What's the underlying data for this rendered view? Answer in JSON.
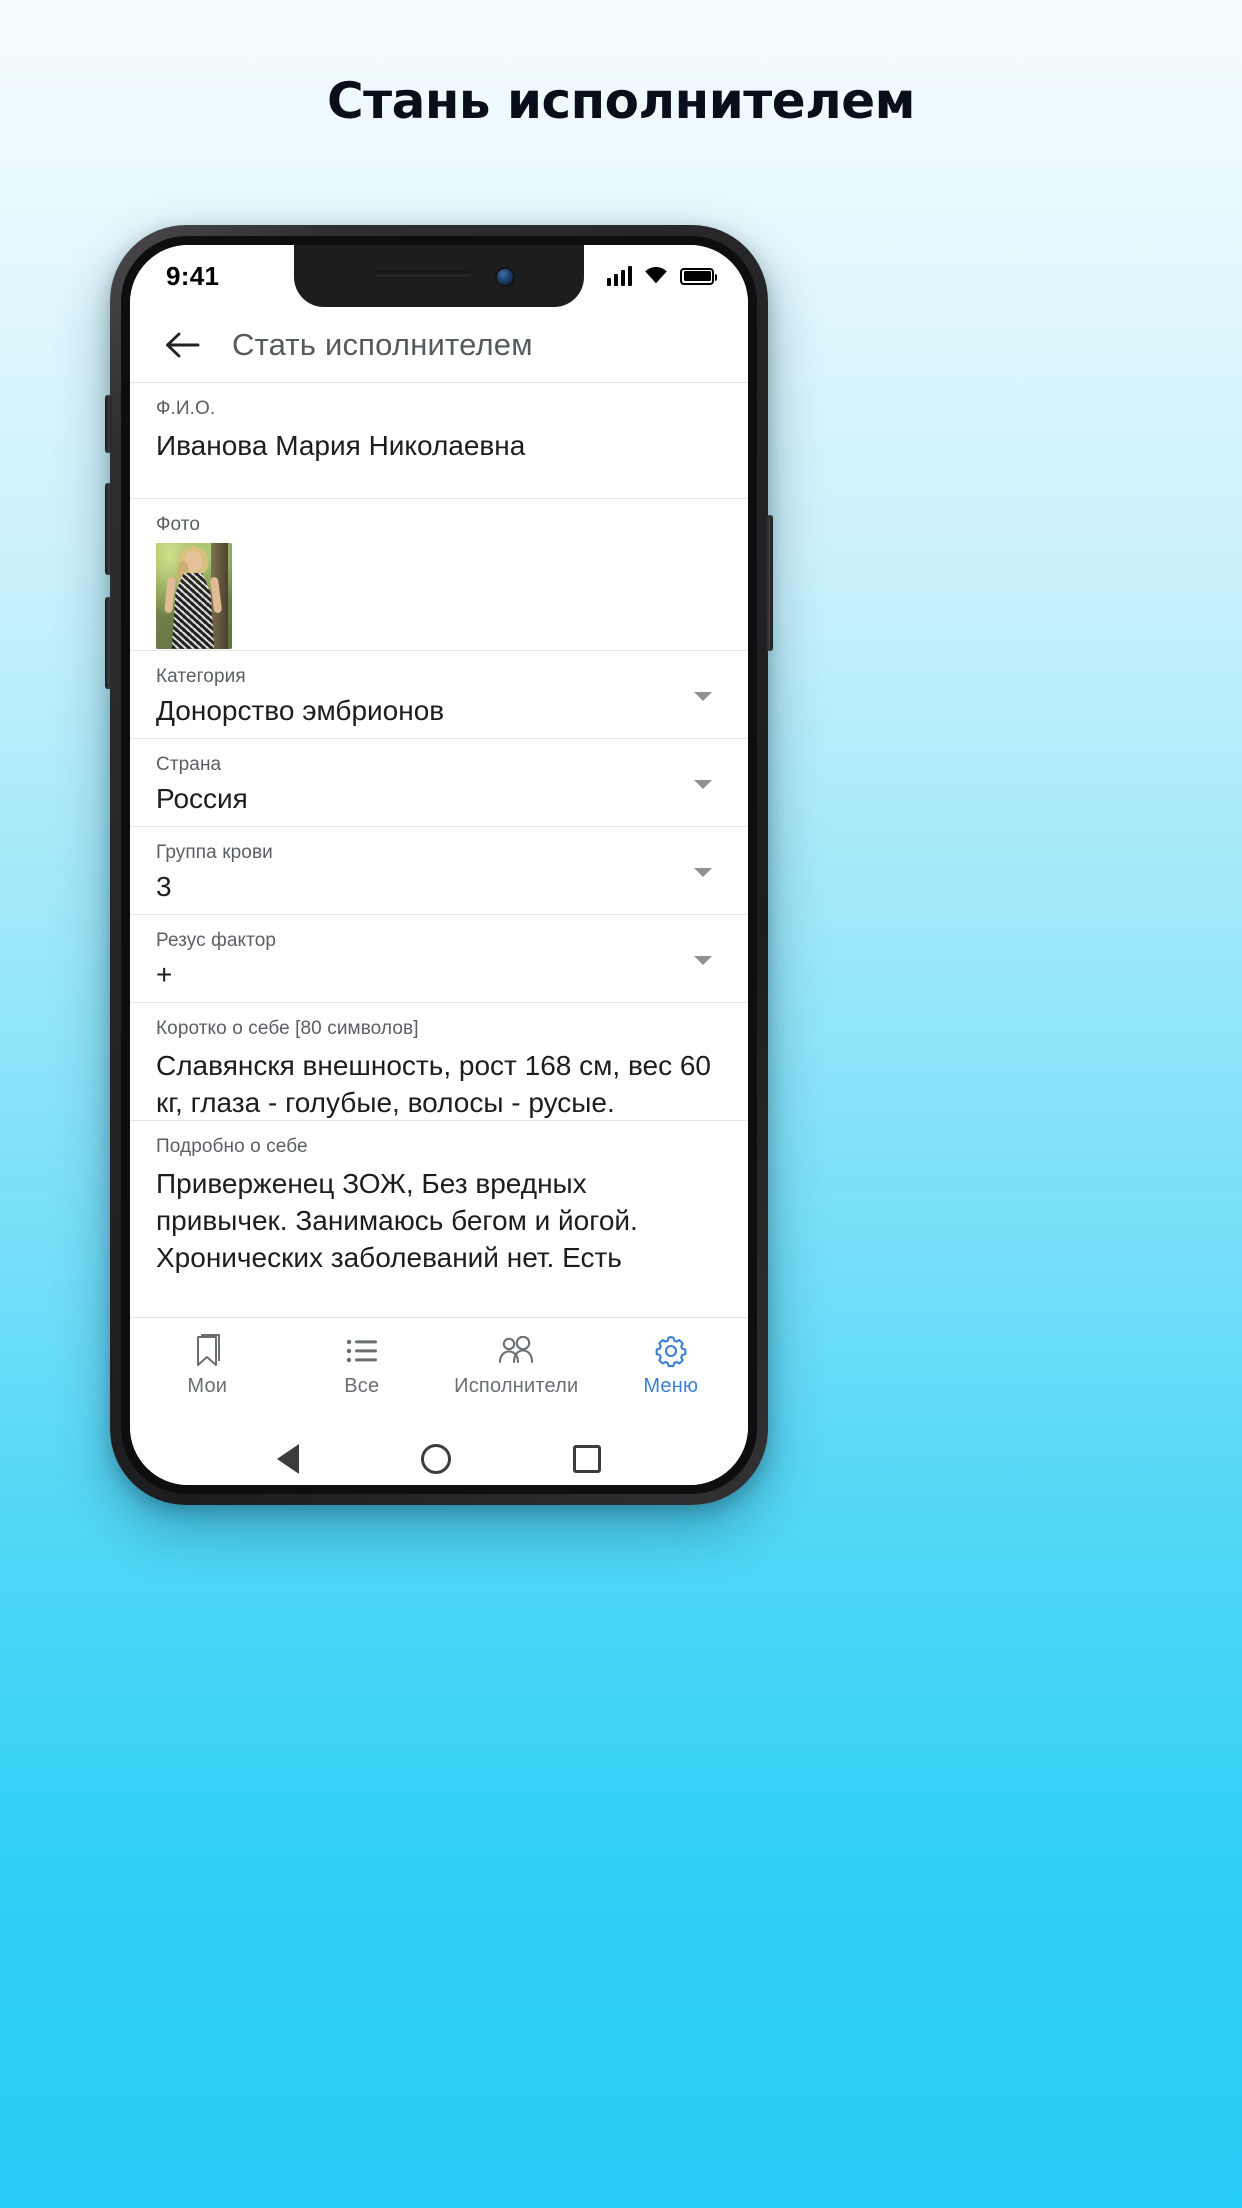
{
  "page": {
    "heading": "Стань исполнителем"
  },
  "status_bar": {
    "time": "9:41",
    "icons": [
      "signal-icon",
      "wifi-icon",
      "battery-icon"
    ]
  },
  "app_header": {
    "back_icon": "back-arrow-icon",
    "title": "Стать исполнителем"
  },
  "form": {
    "fields": [
      {
        "label": "Ф.И.О.",
        "value": "Иванова Мария Николаевна",
        "type": "text"
      },
      {
        "label": "Фото",
        "value": "",
        "type": "photo"
      },
      {
        "label": "Категория",
        "value": "Донорство эмбрионов",
        "type": "select"
      },
      {
        "label": "Страна",
        "value": "Россия",
        "type": "select"
      },
      {
        "label": "Группа крови",
        "value": "3",
        "type": "select"
      },
      {
        "label": "Резус фактор",
        "value": "+",
        "type": "select"
      },
      {
        "label": "Коротко о себе [80 символов]",
        "value": "Славянскя внешность, рост 168 см, вес 60 кг, глаза - голубые, волосы - русые.",
        "type": "textarea"
      },
      {
        "label": "Подробно о себе",
        "value": "Приверженец ЗОЖ, Без вредных привычек. Занимаюсь бегом и йогой. Хронических заболеваний нет. Есть",
        "type": "textarea"
      }
    ]
  },
  "tabbar": {
    "items": [
      {
        "label": "Мои",
        "icon": "bookmark-icon",
        "active": false
      },
      {
        "label": "Все",
        "icon": "list-icon",
        "active": false
      },
      {
        "label": "Исполнители",
        "icon": "people-icon",
        "active": false
      },
      {
        "label": "Меню",
        "icon": "gear-icon",
        "active": true
      }
    ]
  },
  "navbar": {
    "items": [
      "nav-back-icon",
      "nav-home-icon",
      "nav-recent-icon"
    ]
  },
  "colors": {
    "accent": "#3d7fd4",
    "background_top": "#f5fcfe",
    "background_bottom": "#25ccf5",
    "label": "#5a5f63",
    "value": "#1d1d1d"
  }
}
